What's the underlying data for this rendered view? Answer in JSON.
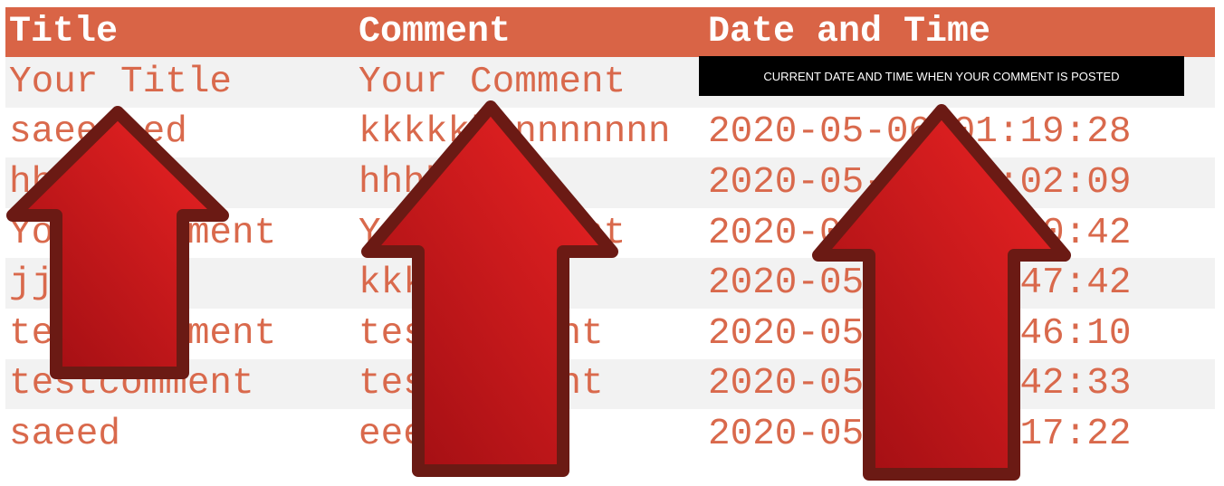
{
  "table": {
    "headers": [
      "Title",
      "Comment",
      "Date and Time"
    ],
    "placeholder_row": {
      "title": "Your Title",
      "comment": "Your Comment"
    },
    "rows": [
      {
        "title": "saeedeed",
        "comment": "kkkkkkknnnnnnn",
        "datetime": "2020-05-06 01:19:28"
      },
      {
        "title": "hhh",
        "comment": "hhhh",
        "datetime": "2020-05-06 01:02:09"
      },
      {
        "title": "Your Comment",
        "comment": "Your Comment",
        "datetime": "2020-05-06 01:00:42"
      },
      {
        "title": "jjj",
        "comment": "kkkk",
        "datetime": "2020-05-06 00:47:42"
      },
      {
        "title": "testcommment",
        "comment": "testcomment",
        "datetime": "2020-05-06 00:46:10"
      },
      {
        "title": "testcomment",
        "comment": "testcomment",
        "datetime": "2020-05-05 23:42:33"
      },
      {
        "title": "saeed",
        "comment": "eeeee",
        "datetime": "2020-05-05 19:17:22"
      }
    ]
  },
  "annotation": {
    "datetime_note": "CURRENT DATE AND TIME WHEN YOUR COMMENT IS POSTED"
  },
  "colors": {
    "header_bg": "#d96446",
    "text": "#d9694c",
    "stripe": "#f2f2f2",
    "arrow_red": "#e3201f",
    "arrow_outline": "#6b1a14"
  },
  "icons": [
    "up-arrow-icon",
    "up-arrow-icon",
    "up-arrow-icon"
  ]
}
